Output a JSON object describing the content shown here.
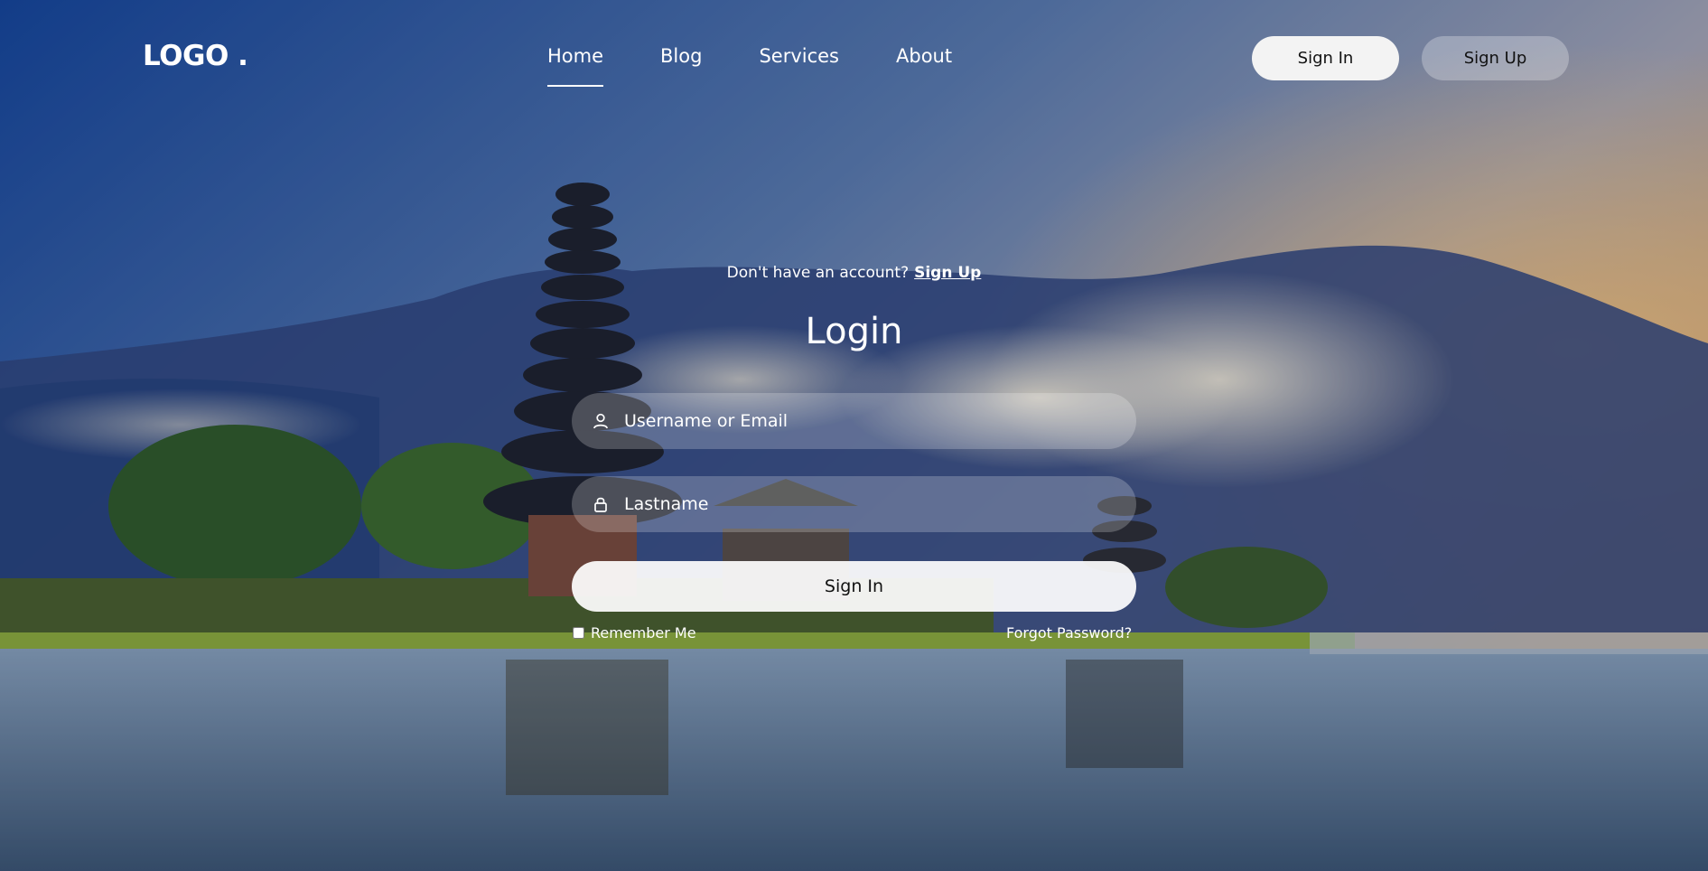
{
  "nav": {
    "logo": "LOGO .",
    "links": [
      {
        "label": "Home",
        "active": true
      },
      {
        "label": "Blog",
        "active": false
      },
      {
        "label": "Services",
        "active": false
      },
      {
        "label": "About",
        "active": false
      }
    ],
    "sign_in_label": "Sign In",
    "sign_up_label": "Sign Up"
  },
  "form": {
    "prompt_text": "Don't have an account?",
    "prompt_link": "Sign Up",
    "title": "Login",
    "username_placeholder": "Username or Email",
    "username_icon": "user-icon",
    "password_placeholder": "Lastname",
    "password_icon": "lock-icon",
    "submit_label": "Sign In",
    "remember_label": "Remember Me",
    "remember_checked": false,
    "forgot_label": "Forgot Password?"
  },
  "colors": {
    "sky_top": "#1b3f8a",
    "mountain": "#2b3f7a",
    "water": "#6d8fb0",
    "sun_glow": "#e9a24a",
    "button_fill": "#f3f3f3"
  }
}
